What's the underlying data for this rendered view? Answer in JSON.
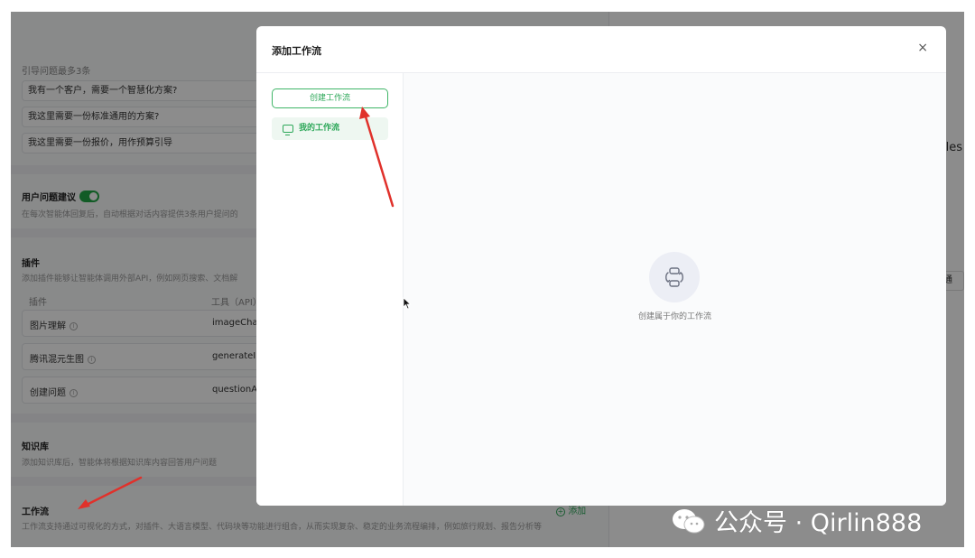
{
  "background": {
    "guide_section_label": "引导问题最多3条",
    "guide_items": [
      "我有一个客户，需要一个智慧化方案?",
      "我这里需要一份标准通用的方案?",
      "我这里需要一份报价，用作预算引导"
    ],
    "suggest_title": "用户问题建议",
    "suggest_desc": "在每次智能体回复后，自动根据对话内容提供3条用户提问的",
    "plugins_title": "插件",
    "plugins_desc": "添加插件能够让智能体调用外部API，例如网页搜索、文档解",
    "plugins_col1": "插件",
    "plugins_col2": "工具（API）",
    "plugins": [
      {
        "name": "图片理解",
        "tool": "imageChat"
      },
      {
        "name": "腾讯混元生图",
        "tool": "generateIm"
      },
      {
        "name": "创建问题",
        "tool": "questionAc"
      }
    ],
    "kb_title": "知识库",
    "kb_desc": "添加知识库后，智能体将根据知识库内容回答用户问题",
    "wf_title": "工作流",
    "wf_add": "添加",
    "wf_desc": "工作流支持通过可视化的方式，对插件、大语言模型、代码块等功能进行组合，从而实现复杂、稳定的业务流程编排，例如旅行规划、报告分析等",
    "right_fragment_1": "les",
    "right_fragment_2": "准通"
  },
  "modal": {
    "title": "添加工作流",
    "close": "×",
    "create_button": "创建工作流",
    "my_workflows": "我的工作流",
    "empty_text": "创建属于你的工作流"
  },
  "watermark": "公众号 · Qirlin888",
  "colors": {
    "accent": "#2ea85a",
    "arrow": "#e0312b"
  }
}
